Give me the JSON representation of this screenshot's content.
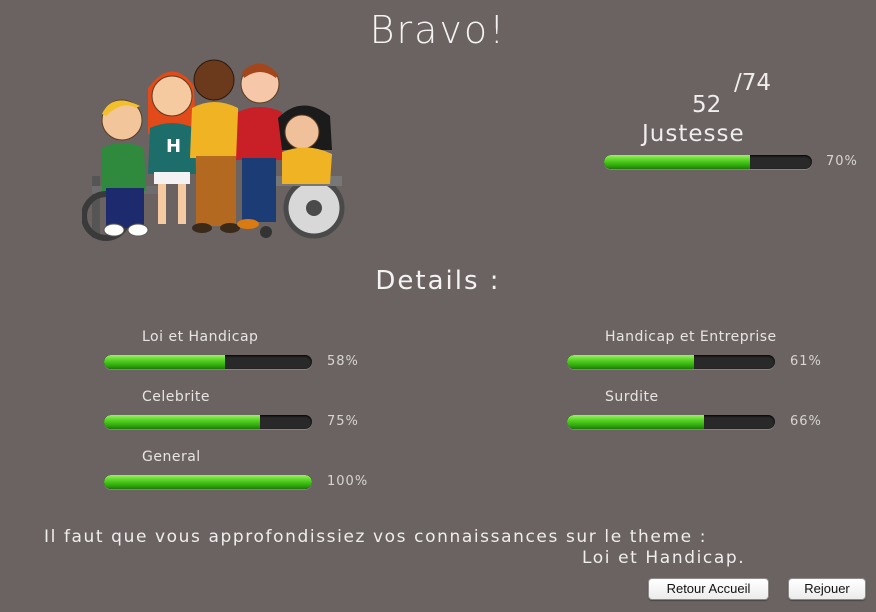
{
  "title": "Bravo!",
  "illustration": {
    "icon": "group-of-kids-illustration"
  },
  "score": {
    "value": "52",
    "total": "/74",
    "label": "Justesse",
    "percent_text": "70%",
    "percent": 70
  },
  "details": {
    "title": "Details :",
    "categories": [
      {
        "label": "Loi et Handicap",
        "percent_text": "58%",
        "percent": 58
      },
      {
        "label": "Handicap et Entreprise",
        "percent_text": "61%",
        "percent": 61
      },
      {
        "label": "Celebrite",
        "percent_text": "75%",
        "percent": 75
      },
      {
        "label": "Surdite",
        "percent_text": "66%",
        "percent": 66
      },
      {
        "label": "General",
        "percent_text": "100%",
        "percent": 100
      }
    ]
  },
  "message": {
    "line1": "Il faut que vous approfondissiez vos connaissances sur le theme :",
    "line2": "Loi et Handicap."
  },
  "buttons": {
    "home": "Retour Accueil",
    "replay": "Rejouer"
  },
  "colors": {
    "background": "#6a6362",
    "bar_fill": "#4cc41c",
    "bar_track": "#2a2929"
  }
}
